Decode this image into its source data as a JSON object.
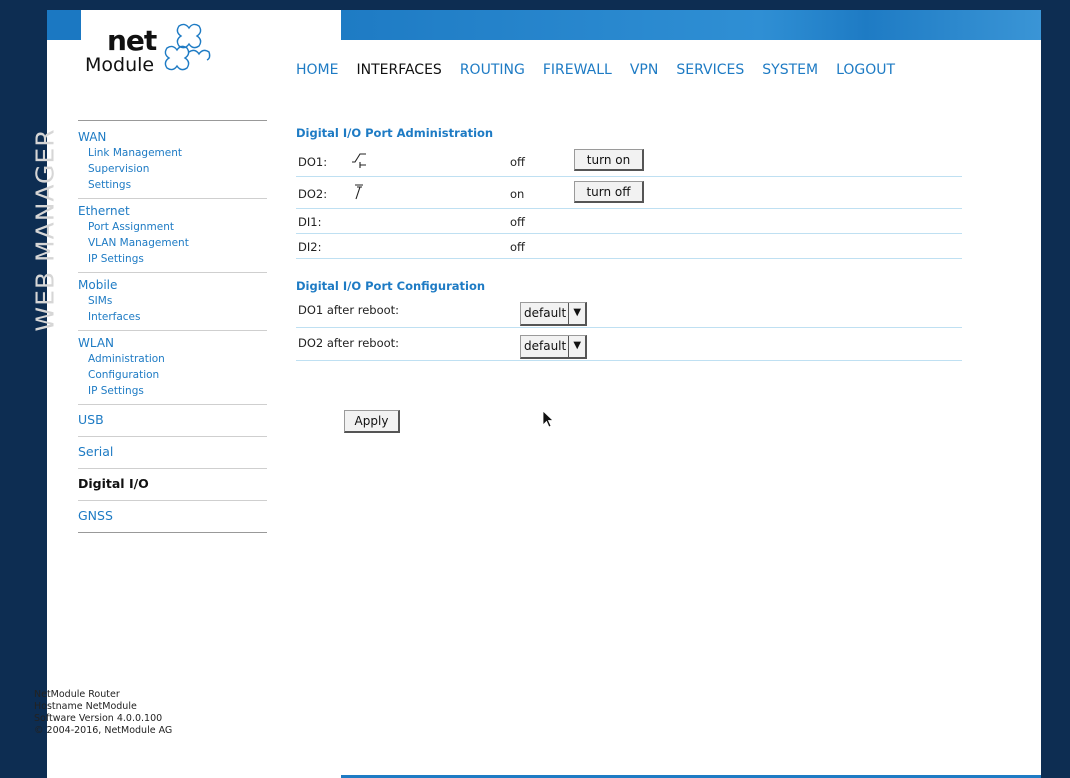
{
  "brand": {
    "logo_top": "net",
    "logo_bottom": "Module",
    "watermark": "WEB MANAGER",
    "accent": "#1e7bc4"
  },
  "nav": [
    {
      "label": "HOME",
      "active": false
    },
    {
      "label": "INTERFACES",
      "active": true
    },
    {
      "label": "ROUTING",
      "active": false
    },
    {
      "label": "FIREWALL",
      "active": false
    },
    {
      "label": "VPN",
      "active": false
    },
    {
      "label": "SERVICES",
      "active": false
    },
    {
      "label": "SYSTEM",
      "active": false
    },
    {
      "label": "LOGOUT",
      "active": false
    }
  ],
  "sidebar": {
    "wan": {
      "label": "WAN",
      "items": [
        "Link Management",
        "Supervision",
        "Settings"
      ]
    },
    "ethernet": {
      "label": "Ethernet",
      "items": [
        "Port Assignment",
        "VLAN Management",
        "IP Settings"
      ]
    },
    "mobile": {
      "label": "Mobile",
      "items": [
        "SIMs",
        "Interfaces"
      ]
    },
    "wlan": {
      "label": "WLAN",
      "items": [
        "Administration",
        "Configuration",
        "IP Settings"
      ]
    },
    "usb": "USB",
    "serial": "Serial",
    "digital_io": "Digital I/O",
    "gnss": "GNSS"
  },
  "admin": {
    "title": "Digital I/O Port Administration",
    "rows": [
      {
        "label": "DO1:",
        "state": "off",
        "button": "turn on",
        "icon": "switch-open-icon"
      },
      {
        "label": "DO2:",
        "state": "on",
        "button": "turn off",
        "icon": "switch-closed-icon"
      },
      {
        "label": "DI1:",
        "state": "off"
      },
      {
        "label": "DI2:",
        "state": "off"
      }
    ]
  },
  "config": {
    "title": "Digital I/O Port Configuration",
    "rows": [
      {
        "label": "DO1 after reboot:",
        "value": "default"
      },
      {
        "label": "DO2 after reboot:",
        "value": "default"
      }
    ],
    "apply": "Apply"
  },
  "footer": {
    "line1": "NetModule Router",
    "line2": "Hostname NetModule",
    "line3": "Software Version 4.0.0.100",
    "line4": "© 2004-2016, NetModule AG"
  }
}
